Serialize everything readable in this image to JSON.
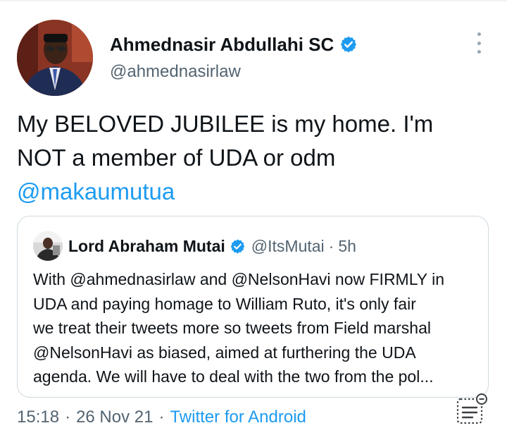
{
  "tweet": {
    "author": {
      "display_name": "Ahmednasir Abdullahi SC",
      "handle": "@ahmednasirlaw",
      "verified_icon": "verified-badge-icon"
    },
    "text_part1": "My BELOVED JUBILEE is my home. I'm NOT a member of UDA or odm",
    "mention": "@makaumutua",
    "quoted": {
      "display_name": "Lord Abraham Mutai",
      "handle": "@ItsMutai",
      "separator": "·",
      "time": "5h",
      "text": "With @ahmednasirlaw and @NelsonHavi now FIRMLY in\nUDA and paying homage to William Ruto, it's only fair\nwe treat their tweets more so tweets from Field marshal\n@NelsonHavi as biased, aimed at furthering the UDA\nagenda. We will have to deal with the two from the pol..."
    },
    "meta": {
      "time": "15:18",
      "separator": "·",
      "date": "26 Nov 21",
      "source": "Twitter for Android"
    }
  },
  "colors": {
    "accent": "#1d9bf0",
    "secondary_text": "#536471",
    "border": "#cfd9de"
  },
  "icons": {
    "more": "more-options-icon",
    "floating": "reader-mode-icon"
  }
}
